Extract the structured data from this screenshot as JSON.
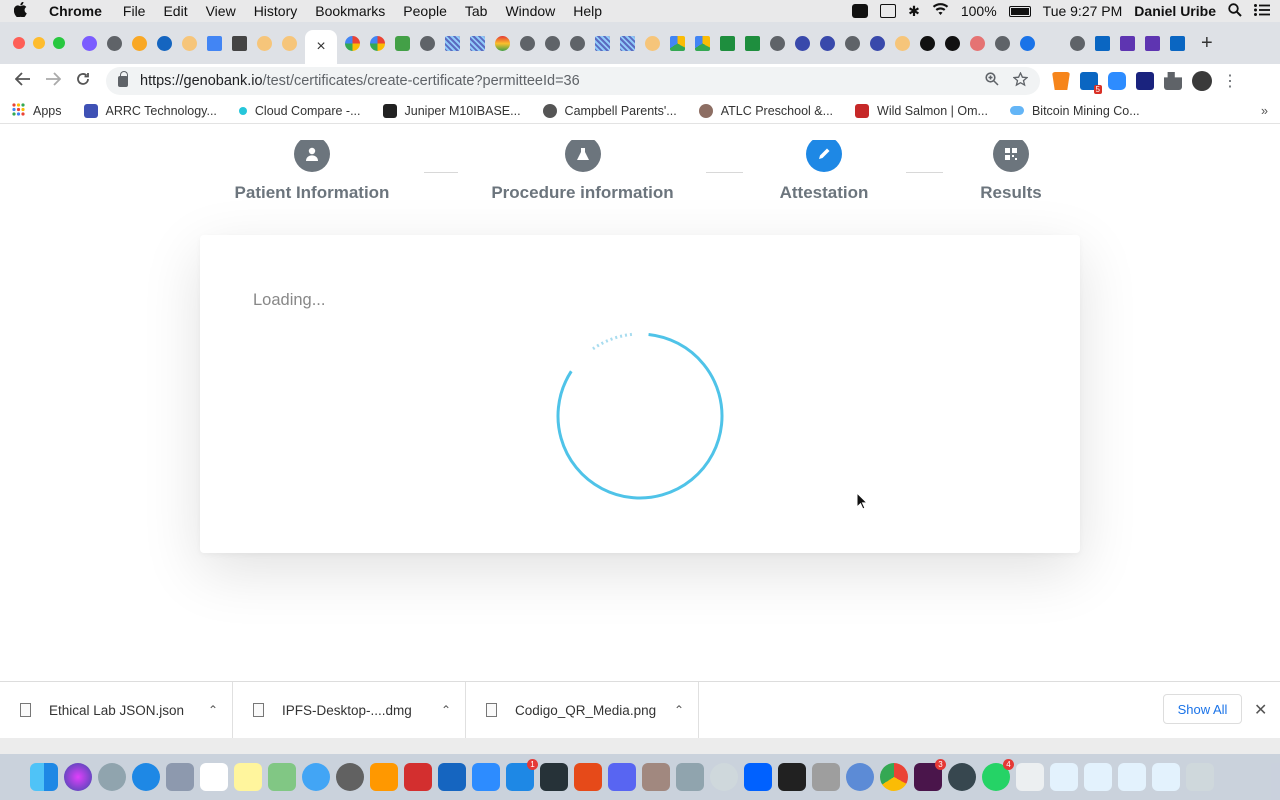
{
  "menubar": {
    "app_name": "Chrome",
    "menus": [
      "File",
      "Edit",
      "View",
      "History",
      "Bookmarks",
      "People",
      "Tab",
      "Window",
      "Help"
    ],
    "battery": "100%",
    "clock": "Tue 9:27 PM",
    "user": "Daniel Uribe"
  },
  "browser": {
    "close_tab_glyph": "×",
    "new_tab_glyph": "+",
    "url_host": "https://genobank.io",
    "url_path": "/test/certificates/create-certificate?permitteeId=36",
    "extension_badge": "5"
  },
  "bookmarks": [
    {
      "label": "Apps",
      "color": "#e53935"
    },
    {
      "label": "ARRC Technology...",
      "color": "#3f51b5"
    },
    {
      "label": "Cloud Compare -...",
      "color": "#26c6da"
    },
    {
      "label": "Juniper M10IBASE...",
      "color": "#222222"
    },
    {
      "label": "Campbell Parents'...",
      "color": "#555555"
    },
    {
      "label": "ATLC Preschool &...",
      "color": "#8d6e63"
    },
    {
      "label": "Wild Salmon | Om...",
      "color": "#c62828"
    },
    {
      "label": "Bitcoin Mining Co...",
      "color": "#64b5f6"
    }
  ],
  "steps": [
    {
      "label": "Patient Information",
      "icon": "user-icon",
      "active": false
    },
    {
      "label": "Procedure information",
      "icon": "flask-icon",
      "active": false
    },
    {
      "label": "Attestation",
      "icon": "pencil-icon",
      "active": true
    },
    {
      "label": "Results",
      "icon": "qr-code-icon",
      "active": false
    }
  ],
  "card": {
    "loading_text": "Loading..."
  },
  "downloads": [
    {
      "name": "Ethical Lab JSON.json"
    },
    {
      "name": "IPFS-Desktop-....dmg"
    },
    {
      "name": "Codigo_QR_Media.png"
    }
  ],
  "download_shelf": {
    "show_all": "Show All"
  },
  "colors": {
    "accent": "#1e88e5",
    "spinner": "#4fc3e8",
    "step_inactive": "#6c757d"
  }
}
